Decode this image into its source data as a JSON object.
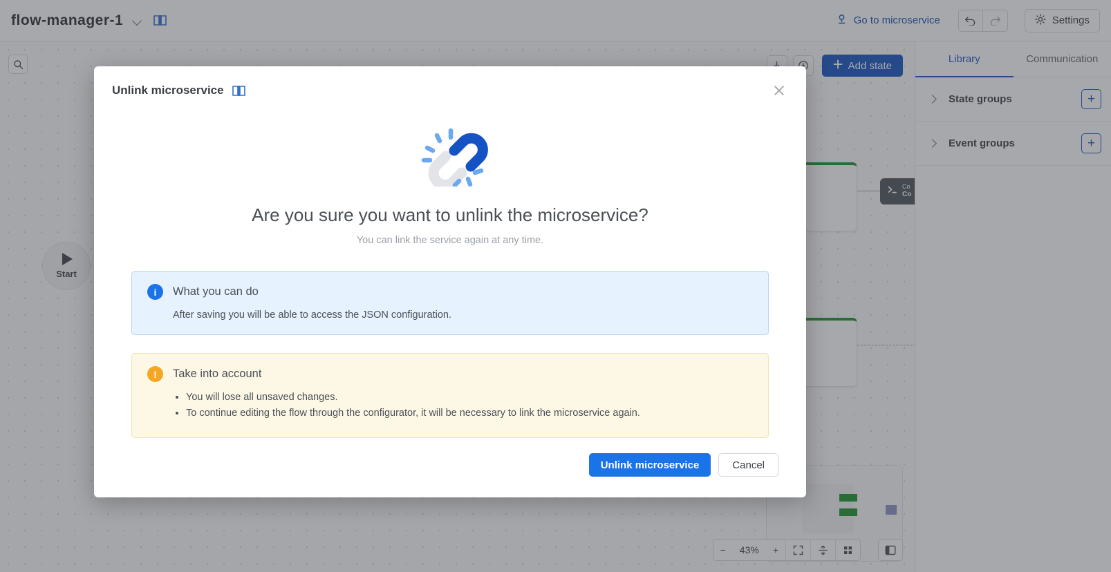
{
  "topbar": {
    "app_title": "flow-manager-1",
    "dropdown_icon": "chevron-down-icon",
    "docs_icon": "book-icon",
    "goto_microservice": "Go to microservice",
    "goto_icon": "microservice-icon",
    "undo_icon": "undo-arrow-icon",
    "redo_icon": "redo-arrow-icon",
    "settings_label": "Settings",
    "settings_icon": "gear-icon"
  },
  "canvas": {
    "search_icon": "search-icon",
    "download_icon": "download-icon",
    "annotate_icon": "annotation-icon",
    "add_state_label": "Add state",
    "add_state_icon": "plus-icon",
    "start_node_label": "Start",
    "terminal_node_line1": "Co",
    "terminal_node_line2": "Co",
    "zoom": {
      "minus": "−",
      "level": "43%",
      "plus": "+",
      "fit_icon": "fit-screen-icon",
      "align_icon": "align-icon",
      "grid_icon": "grid-icon"
    },
    "panel_toggle_icon": "panel-toggle-icon"
  },
  "sidebar": {
    "tabs": [
      {
        "label": "Library",
        "active": true
      },
      {
        "label": "Communication",
        "active": false
      }
    ],
    "groups": [
      {
        "label": "State groups",
        "add_icon": "plus-icon"
      },
      {
        "label": "Event groups",
        "add_icon": "plus-icon"
      }
    ]
  },
  "modal": {
    "title": "Unlink microservice",
    "docs_icon": "book-icon",
    "close_icon": "close-icon",
    "illustration": "broken-link-icon",
    "headline": "Are you sure you want to unlink the microservice?",
    "subline": "You can link the service again at any time.",
    "info": {
      "icon": "info-icon",
      "title": "What you can do",
      "text": "After saving you will be able to access the JSON configuration."
    },
    "warning": {
      "icon": "warning-icon",
      "title": "Take into account",
      "items": [
        "You will lose all unsaved changes.",
        "To continue editing the flow through the configurator, it will be necessary to link the microservice again."
      ]
    },
    "confirm_label": "Unlink microservice",
    "cancel_label": "Cancel"
  },
  "colors": {
    "brand_blue": "#1552c4",
    "action_blue": "#1a73e8",
    "link_blue": "#1b53b5",
    "info_bg": "#e6f2fd",
    "warn_bg": "#fdf8e6",
    "warn_icon": "#f5a623",
    "node_green": "#189429"
  }
}
